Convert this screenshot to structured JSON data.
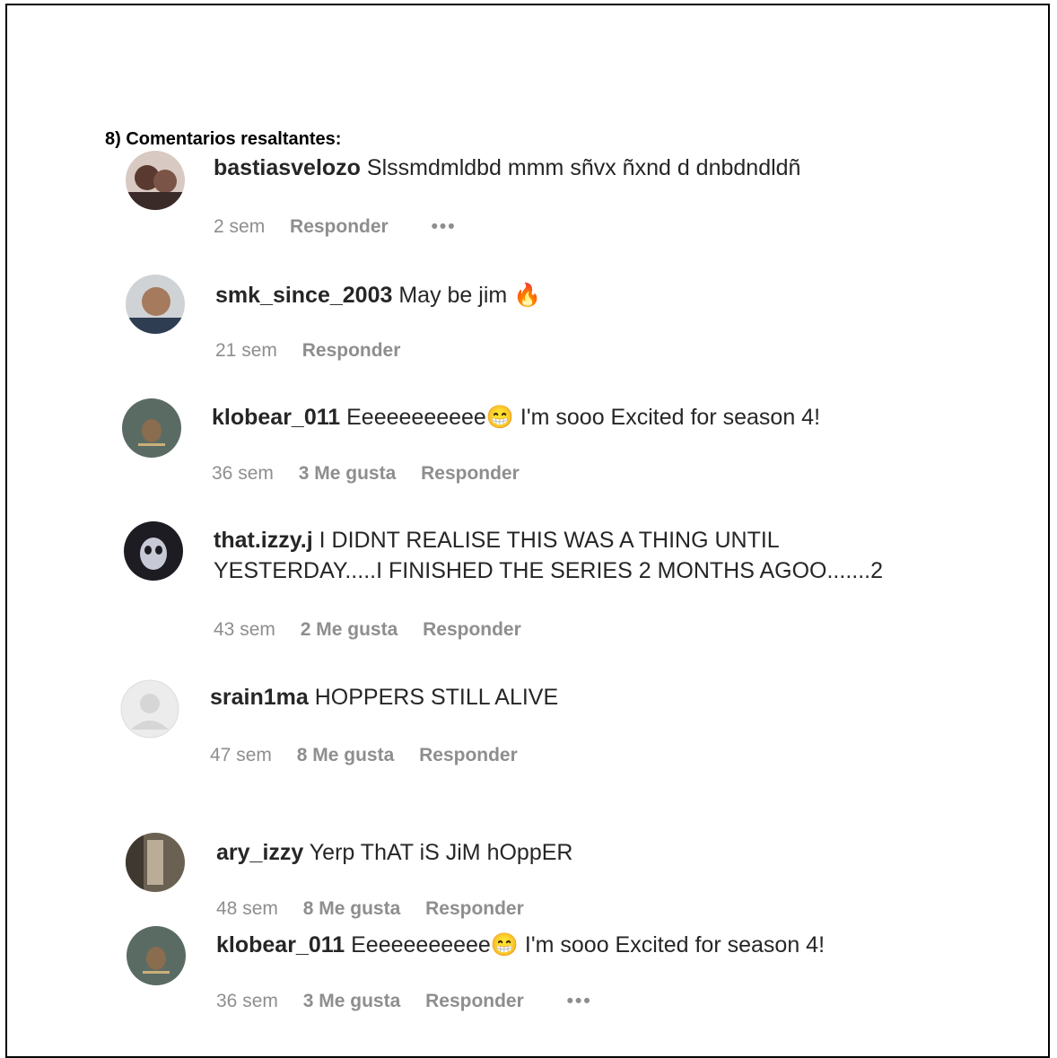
{
  "heading": "8) Comentarios resaltantes:",
  "comments": [
    {
      "user": "bastiasvelozo",
      "text": "Slssmdmldbd mmm sñvx ñxnd d dnbdndldñ",
      "time": "2 sem",
      "likes": "",
      "reply": "Responder",
      "more": "•••"
    },
    {
      "user": "smk_since_2003",
      "text": "May be jim 🔥",
      "time": "21 sem",
      "likes": "",
      "reply": "Responder",
      "more": ""
    },
    {
      "user": "klobear_011",
      "text": "Eeeeeeeeeee😁 I'm sooo Excited for season 4!",
      "time": "36 sem",
      "likes": "3 Me gusta",
      "reply": "Responder",
      "more": ""
    },
    {
      "user": "that.izzy.j",
      "text": "I DIDNT REALISE THIS WAS A THING UNTIL YESTERDAY.....I FINISHED THE SERIES 2 MONTHS AGOO.......2",
      "time": "43 sem",
      "likes": "2 Me gusta",
      "reply": "Responder",
      "more": ""
    },
    {
      "user": "srain1ma",
      "text": "HOPPERS STILL ALIVE",
      "time": "47 sem",
      "likes": "8 Me gusta",
      "reply": "Responder",
      "more": ""
    },
    {
      "user": "ary_izzy",
      "text": "Yerp ThAT iS JiM hOppER",
      "time": "48 sem",
      "likes": "8 Me gusta",
      "reply": "Responder",
      "more": ""
    },
    {
      "user": "klobear_011",
      "text": "Eeeeeeeeeee😁 I'm sooo Excited for season 4!",
      "time": "36 sem",
      "likes": "3 Me gusta",
      "reply": "Responder",
      "more": "•••"
    }
  ],
  "colors": {
    "username": "#262626",
    "meta": "#8e8e8e"
  }
}
